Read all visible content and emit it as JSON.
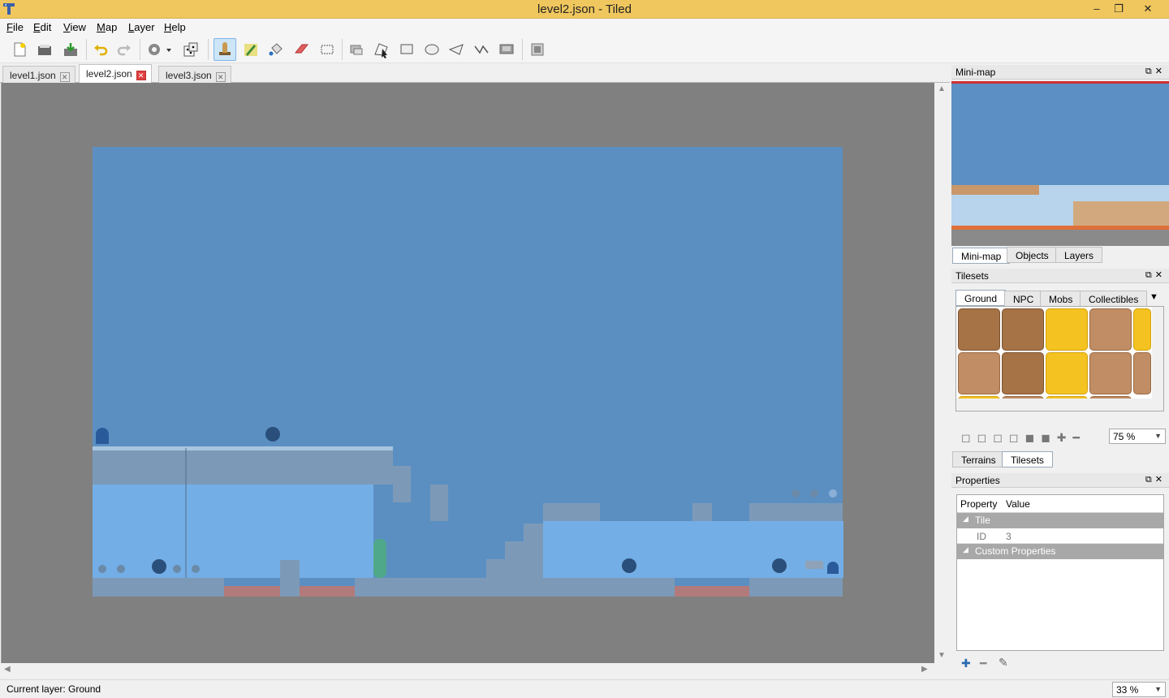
{
  "window": {
    "title": "level2.json - Tiled",
    "controls": {
      "minimize": "–",
      "maximize": "❐",
      "close": "✕"
    }
  },
  "menu": [
    {
      "label": "File",
      "key": "F",
      "rest": "ile"
    },
    {
      "label": "Edit",
      "key": "E",
      "rest": "dit"
    },
    {
      "label": "View",
      "key": "V",
      "rest": "iew"
    },
    {
      "label": "Map",
      "key": "M",
      "rest": "ap"
    },
    {
      "label": "Layer",
      "key": "L",
      "rest": "ayer"
    },
    {
      "label": "Help",
      "key": "H",
      "rest": "elp"
    }
  ],
  "toolbar": {
    "icons": [
      "new-map-icon",
      "open-icon",
      "save-icon",
      "undo-icon",
      "redo-icon",
      "commands-icon",
      "random-mode-icon",
      "stamp-brush-icon",
      "terrain-brush-icon",
      "bucket-fill-icon",
      "eraser-icon",
      "rect-select-icon",
      "select-objects-icon",
      "edit-polygons-icon",
      "insert-rectangle-icon",
      "insert-ellipse-icon",
      "insert-polygon-icon",
      "insert-polyline-icon",
      "insert-tile-icon",
      "magic-wand-icon"
    ],
    "active": "stamp-brush-icon"
  },
  "tabs": [
    {
      "label": "level1.json",
      "active": false
    },
    {
      "label": "level2.json",
      "active": true
    },
    {
      "label": "level3.json",
      "active": false
    }
  ],
  "minimap": {
    "title": "Mini-map",
    "tabs": [
      "Mini-map",
      "Objects",
      "Layers"
    ]
  },
  "tilesets": {
    "title": "Tilesets",
    "tabs": [
      "Ground",
      "NPC",
      "Mobs",
      "Collectibles"
    ],
    "zoom": "75 %",
    "bottom_tabs": [
      "Terrains",
      "Tilesets"
    ]
  },
  "properties": {
    "title": "Properties",
    "columns": [
      "Property",
      "Value"
    ],
    "groups": [
      {
        "label": "Tile",
        "rows": [
          {
            "name": "ID",
            "value": "3"
          }
        ]
      },
      {
        "label": "Custom Properties",
        "rows": []
      }
    ]
  },
  "status": {
    "text": "Current layer: Ground",
    "zoom": "33 %"
  },
  "colors": {
    "titlebar": "#f0c75e",
    "sky": "#5b8fc2",
    "water": "#6ea8e0",
    "ground": "#8fa6c0",
    "tile_brown": "#a67346",
    "tile_yellow": "#f4c321"
  }
}
